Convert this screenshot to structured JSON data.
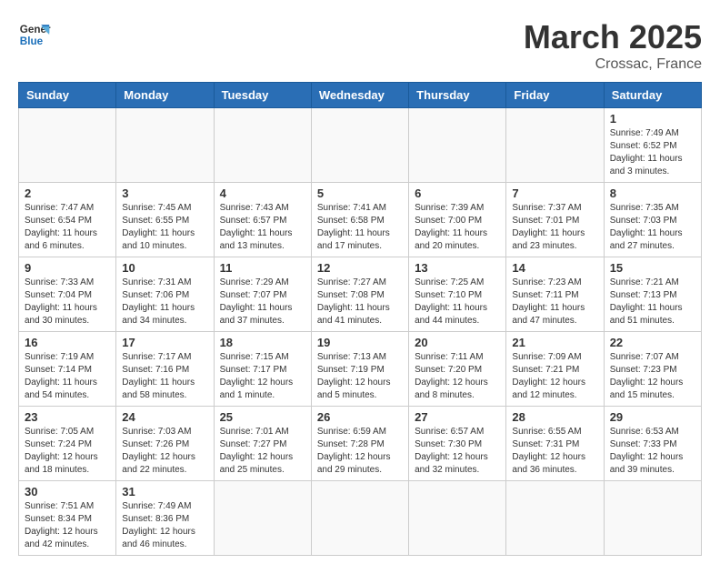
{
  "header": {
    "logo_general": "General",
    "logo_blue": "Blue",
    "month_title": "March 2025",
    "location": "Crossac, France"
  },
  "days_of_week": [
    "Sunday",
    "Monday",
    "Tuesday",
    "Wednesday",
    "Thursday",
    "Friday",
    "Saturday"
  ],
  "weeks": [
    [
      {
        "day": "",
        "info": ""
      },
      {
        "day": "",
        "info": ""
      },
      {
        "day": "",
        "info": ""
      },
      {
        "day": "",
        "info": ""
      },
      {
        "day": "",
        "info": ""
      },
      {
        "day": "",
        "info": ""
      },
      {
        "day": "1",
        "info": "Sunrise: 7:49 AM\nSunset: 6:52 PM\nDaylight: 11 hours\nand 3 minutes."
      }
    ],
    [
      {
        "day": "2",
        "info": "Sunrise: 7:47 AM\nSunset: 6:54 PM\nDaylight: 11 hours\nand 6 minutes."
      },
      {
        "day": "3",
        "info": "Sunrise: 7:45 AM\nSunset: 6:55 PM\nDaylight: 11 hours\nand 10 minutes."
      },
      {
        "day": "4",
        "info": "Sunrise: 7:43 AM\nSunset: 6:57 PM\nDaylight: 11 hours\nand 13 minutes."
      },
      {
        "day": "5",
        "info": "Sunrise: 7:41 AM\nSunset: 6:58 PM\nDaylight: 11 hours\nand 17 minutes."
      },
      {
        "day": "6",
        "info": "Sunrise: 7:39 AM\nSunset: 7:00 PM\nDaylight: 11 hours\nand 20 minutes."
      },
      {
        "day": "7",
        "info": "Sunrise: 7:37 AM\nSunset: 7:01 PM\nDaylight: 11 hours\nand 23 minutes."
      },
      {
        "day": "8",
        "info": "Sunrise: 7:35 AM\nSunset: 7:03 PM\nDaylight: 11 hours\nand 27 minutes."
      }
    ],
    [
      {
        "day": "9",
        "info": "Sunrise: 7:33 AM\nSunset: 7:04 PM\nDaylight: 11 hours\nand 30 minutes."
      },
      {
        "day": "10",
        "info": "Sunrise: 7:31 AM\nSunset: 7:06 PM\nDaylight: 11 hours\nand 34 minutes."
      },
      {
        "day": "11",
        "info": "Sunrise: 7:29 AM\nSunset: 7:07 PM\nDaylight: 11 hours\nand 37 minutes."
      },
      {
        "day": "12",
        "info": "Sunrise: 7:27 AM\nSunset: 7:08 PM\nDaylight: 11 hours\nand 41 minutes."
      },
      {
        "day": "13",
        "info": "Sunrise: 7:25 AM\nSunset: 7:10 PM\nDaylight: 11 hours\nand 44 minutes."
      },
      {
        "day": "14",
        "info": "Sunrise: 7:23 AM\nSunset: 7:11 PM\nDaylight: 11 hours\nand 47 minutes."
      },
      {
        "day": "15",
        "info": "Sunrise: 7:21 AM\nSunset: 7:13 PM\nDaylight: 11 hours\nand 51 minutes."
      }
    ],
    [
      {
        "day": "16",
        "info": "Sunrise: 7:19 AM\nSunset: 7:14 PM\nDaylight: 11 hours\nand 54 minutes."
      },
      {
        "day": "17",
        "info": "Sunrise: 7:17 AM\nSunset: 7:16 PM\nDaylight: 11 hours\nand 58 minutes."
      },
      {
        "day": "18",
        "info": "Sunrise: 7:15 AM\nSunset: 7:17 PM\nDaylight: 12 hours\nand 1 minute."
      },
      {
        "day": "19",
        "info": "Sunrise: 7:13 AM\nSunset: 7:19 PM\nDaylight: 12 hours\nand 5 minutes."
      },
      {
        "day": "20",
        "info": "Sunrise: 7:11 AM\nSunset: 7:20 PM\nDaylight: 12 hours\nand 8 minutes."
      },
      {
        "day": "21",
        "info": "Sunrise: 7:09 AM\nSunset: 7:21 PM\nDaylight: 12 hours\nand 12 minutes."
      },
      {
        "day": "22",
        "info": "Sunrise: 7:07 AM\nSunset: 7:23 PM\nDaylight: 12 hours\nand 15 minutes."
      }
    ],
    [
      {
        "day": "23",
        "info": "Sunrise: 7:05 AM\nSunset: 7:24 PM\nDaylight: 12 hours\nand 18 minutes."
      },
      {
        "day": "24",
        "info": "Sunrise: 7:03 AM\nSunset: 7:26 PM\nDaylight: 12 hours\nand 22 minutes."
      },
      {
        "day": "25",
        "info": "Sunrise: 7:01 AM\nSunset: 7:27 PM\nDaylight: 12 hours\nand 25 minutes."
      },
      {
        "day": "26",
        "info": "Sunrise: 6:59 AM\nSunset: 7:28 PM\nDaylight: 12 hours\nand 29 minutes."
      },
      {
        "day": "27",
        "info": "Sunrise: 6:57 AM\nSunset: 7:30 PM\nDaylight: 12 hours\nand 32 minutes."
      },
      {
        "day": "28",
        "info": "Sunrise: 6:55 AM\nSunset: 7:31 PM\nDaylight: 12 hours\nand 36 minutes."
      },
      {
        "day": "29",
        "info": "Sunrise: 6:53 AM\nSunset: 7:33 PM\nDaylight: 12 hours\nand 39 minutes."
      }
    ],
    [
      {
        "day": "30",
        "info": "Sunrise: 7:51 AM\nSunset: 8:34 PM\nDaylight: 12 hours\nand 42 minutes."
      },
      {
        "day": "31",
        "info": "Sunrise: 7:49 AM\nSunset: 8:36 PM\nDaylight: 12 hours\nand 46 minutes."
      },
      {
        "day": "",
        "info": ""
      },
      {
        "day": "",
        "info": ""
      },
      {
        "day": "",
        "info": ""
      },
      {
        "day": "",
        "info": ""
      },
      {
        "day": "",
        "info": ""
      }
    ]
  ]
}
